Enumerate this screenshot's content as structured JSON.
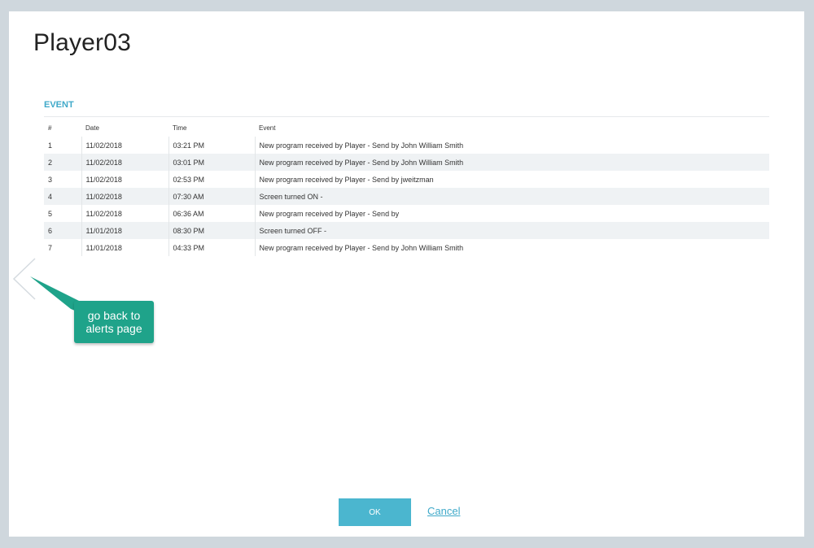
{
  "dialog": {
    "title": "Player03",
    "section_label": "EVENT"
  },
  "table": {
    "headers": {
      "num": "#",
      "date": "Date",
      "time": "Time",
      "event": "Event"
    },
    "rows": [
      {
        "num": "1",
        "date": "11/02/2018",
        "time": "03:21 PM",
        "event": "New program received by Player - Send by John William Smith"
      },
      {
        "num": "2",
        "date": "11/02/2018",
        "time": "03:01 PM",
        "event": "New program received by Player - Send by John William Smith"
      },
      {
        "num": "3",
        "date": "11/02/2018",
        "time": "02:53 PM",
        "event": "New program received by Player - Send by jweitzman"
      },
      {
        "num": "4",
        "date": "11/02/2018",
        "time": "07:30 AM",
        "event": "Screen turned ON -"
      },
      {
        "num": "5",
        "date": "11/02/2018",
        "time": "06:36 AM",
        "event": "New program received by Player - Send by"
      },
      {
        "num": "6",
        "date": "11/01/2018",
        "time": "08:30 PM",
        "event": "Screen turned OFF -"
      },
      {
        "num": "7",
        "date": "11/01/2018",
        "time": "04:33 PM",
        "event": "New program received by Player - Send by John William Smith"
      }
    ]
  },
  "annotation": {
    "line1": "go back to",
    "line2": "alerts page"
  },
  "footer": {
    "ok_label": "OK",
    "cancel_label": "Cancel"
  },
  "icons": {
    "back": "chevron-left-icon"
  },
  "colors": {
    "accent": "#4bb6cf",
    "link": "#3fa9c9",
    "callout": "#1fa38a",
    "background": "#cfd7dd"
  }
}
